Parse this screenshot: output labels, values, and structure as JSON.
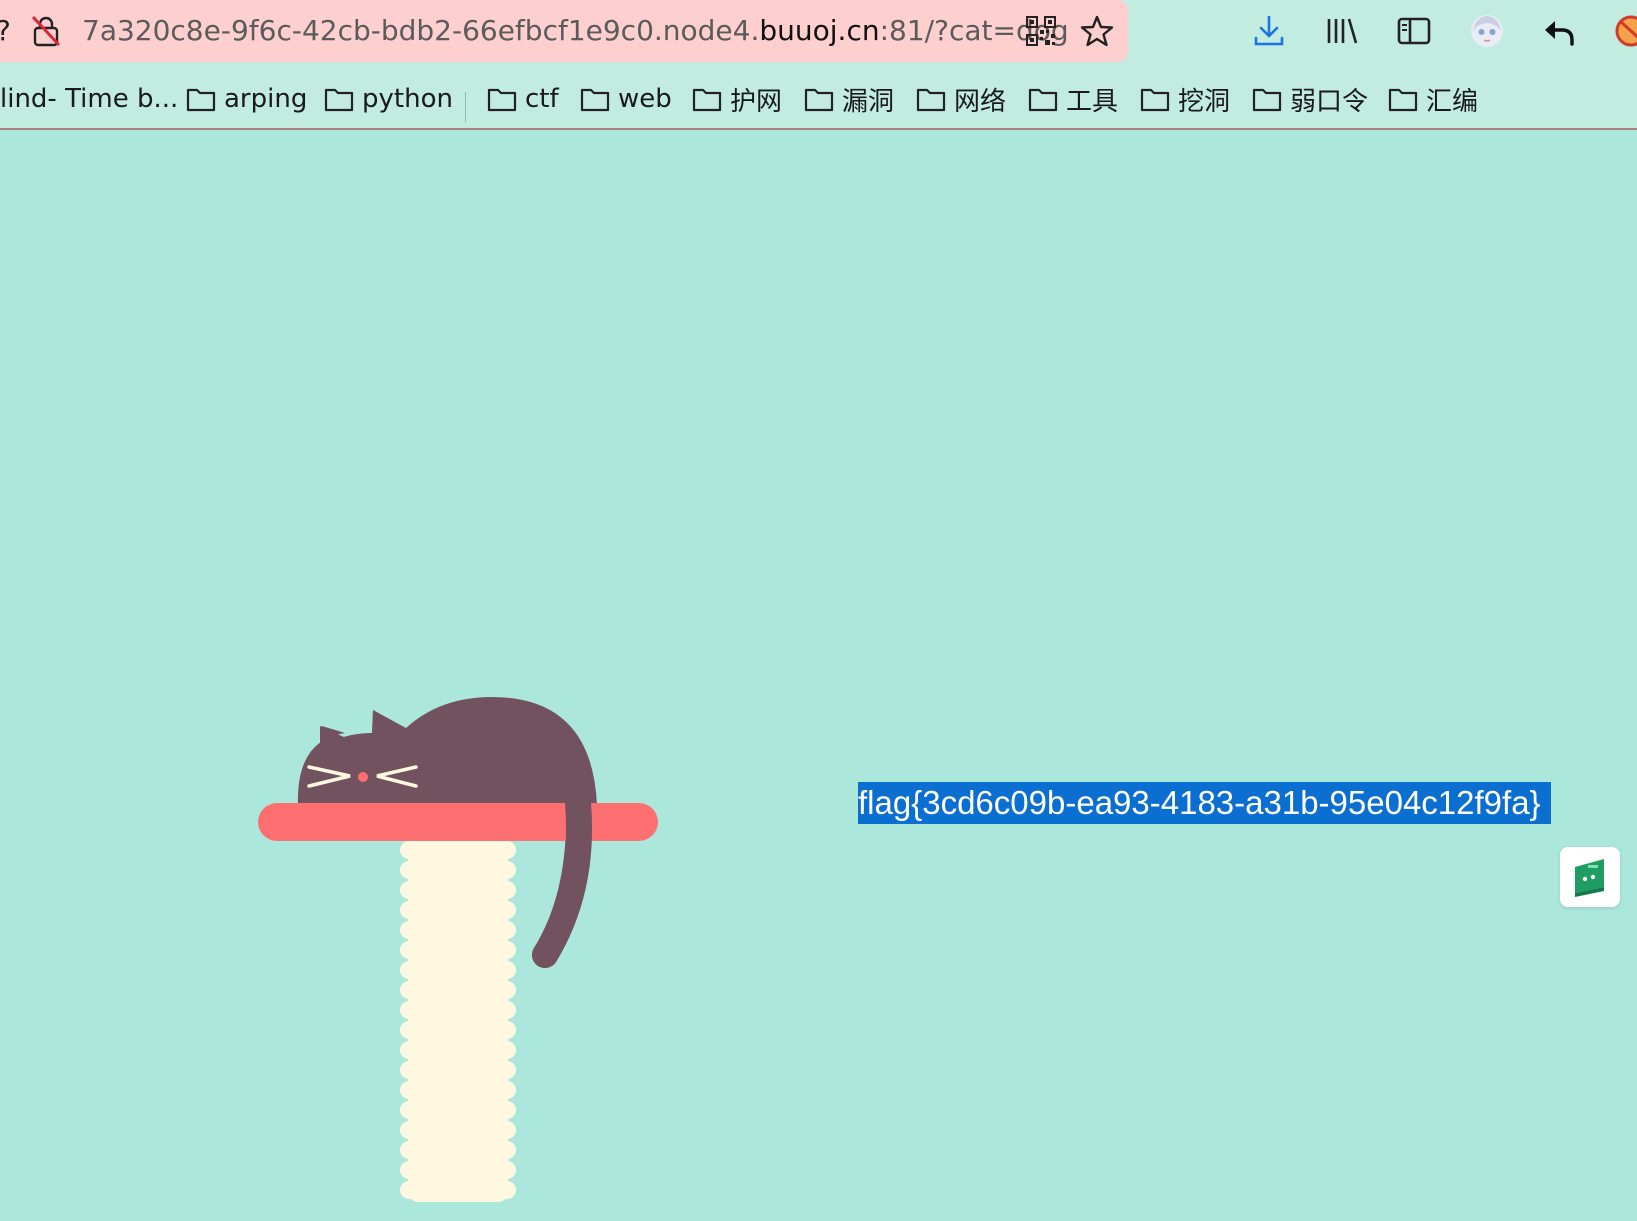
{
  "browser": {
    "url": {
      "prefix": "7a320c8e-9f6c-42cb-bdb2-66efbcf1e9c0.node4.",
      "host": "buuoj.cn",
      "suffix": ":81/?cat=dog"
    },
    "bookmarks": [
      {
        "label": "lind- Time b..."
      },
      {
        "label": "arping"
      },
      {
        "label": "python"
      },
      {
        "label": "ctf"
      },
      {
        "label": "web"
      },
      {
        "label": "护网"
      },
      {
        "label": "漏洞"
      },
      {
        "label": "网络"
      },
      {
        "label": "工具"
      },
      {
        "label": "挖洞"
      },
      {
        "label": "弱口令"
      },
      {
        "label": "汇编"
      }
    ],
    "toolbar_icons": [
      "download-icon",
      "library-icon",
      "sidebar-icon",
      "avatar-icon",
      "back-arrow-icon",
      "blocked-extension-icon"
    ]
  },
  "page": {
    "flag_text": "flag{3cd6c09b-ea93-4183-a31b-95e04c12f9fa}",
    "colors": {
      "background": "#ace7dc",
      "cat": "#735260",
      "perch": "#fd6f71",
      "post": "#fff8e1",
      "selection": "#0a6fd0"
    }
  }
}
